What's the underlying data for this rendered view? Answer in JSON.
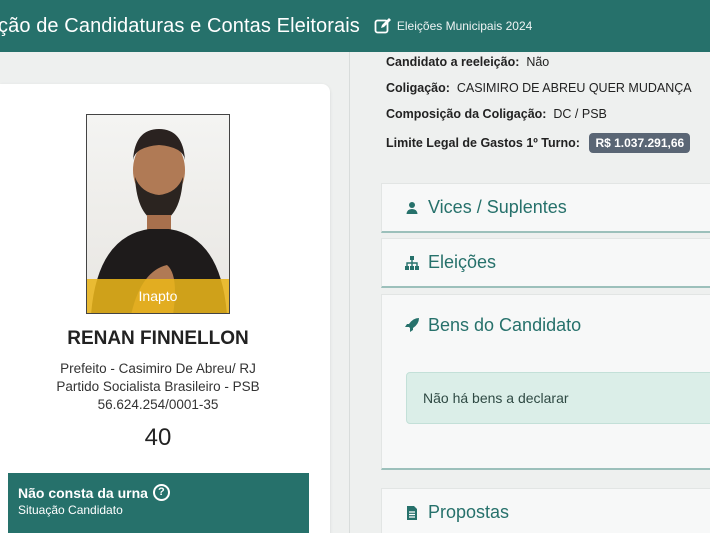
{
  "header": {
    "title": "ção de Candidaturas e Contas Eleitorais",
    "subtitle": "Eleições Municipais 2024"
  },
  "candidate": {
    "photo_badge": "Inapto",
    "name": "RENAN FINNELLON",
    "role": "Prefeito - Casimiro De Abreu/ RJ",
    "party": "Partido Socialista Brasileiro - PSB",
    "cnpj": "56.624.254/0001-35",
    "number": "40",
    "status_title": "Não consta da urna",
    "status_sub": "Situação Candidato"
  },
  "info": {
    "reeleicao_label": "Candidato a reeleição:",
    "reeleicao_value": "Não",
    "coligacao_label": "Coligação:",
    "coligacao_value": "CASIMIRO DE ABREU QUER MUDANÇA",
    "composicao_label": "Composição da Coligação:",
    "composicao_value": "DC / PSB",
    "limite_label": "Limite Legal de Gastos 1º Turno:",
    "limite_value": "R$ 1.037.291,66"
  },
  "sections": {
    "vices": "Vices / Suplentes",
    "eleicoes": "Eleições",
    "bens": "Bens do Candidato",
    "bens_empty": "Não há bens a declarar",
    "propostas": "Propostas"
  },
  "colors": {
    "primary": "#26716b",
    "badge_gray": "#5a6675",
    "inapto_yellow": "#e8b41a",
    "empty_bg": "#dbeee8"
  }
}
